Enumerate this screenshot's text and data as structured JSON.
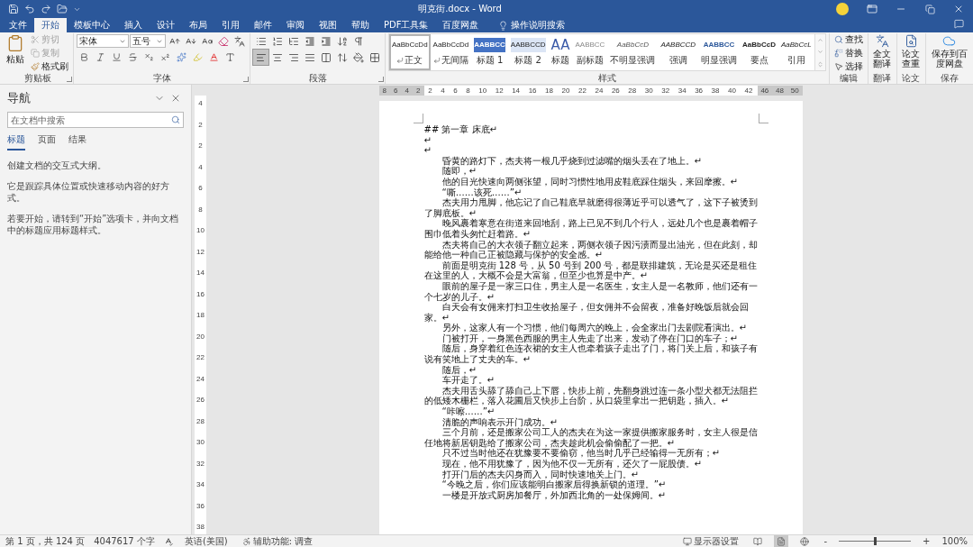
{
  "title_bar": {
    "title": "明克街.docx  -  Word"
  },
  "tabs": [
    {
      "label": "文件",
      "selected": false
    },
    {
      "label": "开始",
      "selected": true
    },
    {
      "label": "模板中心",
      "selected": false
    },
    {
      "label": "插入",
      "selected": false
    },
    {
      "label": "设计",
      "selected": false
    },
    {
      "label": "布局",
      "selected": false
    },
    {
      "label": "引用",
      "selected": false
    },
    {
      "label": "邮件",
      "selected": false
    },
    {
      "label": "审阅",
      "selected": false
    },
    {
      "label": "视图",
      "selected": false
    },
    {
      "label": "帮助",
      "selected": false
    },
    {
      "label": "PDF工具集",
      "selected": false
    },
    {
      "label": "百度网盘",
      "selected": false
    }
  ],
  "tell_me": "操作说明搜索",
  "clipboard": {
    "label": "剪贴板",
    "paste": "粘贴",
    "cut": {
      "label": "剪切",
      "disabled": true
    },
    "copy": {
      "label": "复制",
      "disabled": true
    },
    "format_painter": "格式刷"
  },
  "font": {
    "label": "字体",
    "name": "宋体",
    "size": "五号"
  },
  "paragraph": {
    "label": "段落",
    "alignments": [
      {
        "kind": "left",
        "selected": true
      },
      {
        "kind": "center",
        "selected": false
      },
      {
        "kind": "right",
        "selected": false
      },
      {
        "kind": "justify",
        "selected": false
      },
      {
        "kind": "distributed",
        "selected": false
      }
    ]
  },
  "styles": {
    "label": "样式",
    "items": [
      {
        "kind": "normal",
        "preview": "AaBbCcDd",
        "name": "正文",
        "selected": true
      },
      {
        "kind": "nospace",
        "preview": "AaBbCcDd",
        "name": "无间隔",
        "selected": false
      },
      {
        "kind": "h1",
        "preview": "AABBCC",
        "name": "标题 1",
        "selected": false
      },
      {
        "kind": "h2",
        "preview": "AABBCCD",
        "name": "标题 2",
        "selected": false
      },
      {
        "kind": "title",
        "preview": "AA",
        "name": "标题",
        "selected": false
      },
      {
        "kind": "subtitle",
        "preview": "AABBCC",
        "name": "副标题",
        "selected": false
      },
      {
        "kind": "subtle",
        "preview": "AaBbCcD",
        "name": "不明显强调",
        "selected": false
      },
      {
        "kind": "emphasis",
        "preview": "AABBCCD",
        "name": "强调",
        "selected": false
      },
      {
        "kind": "intense",
        "preview": "AABBCC",
        "name": "明显强调",
        "selected": false
      },
      {
        "kind": "strong",
        "preview": "AaBbCcD",
        "name": "要点",
        "selected": false
      },
      {
        "kind": "quote",
        "preview": "AaBbCcL",
        "name": "引用",
        "selected": false
      }
    ]
  },
  "editing": {
    "label": "编辑",
    "find": "查找",
    "replace": "替换",
    "select": "选择"
  },
  "translate": {
    "label": "翻译",
    "button": "全文翻译"
  },
  "thesis": {
    "label": "论文",
    "button": "论文查重"
  },
  "save": {
    "label": "保存",
    "button": "保存到百度网盘"
  },
  "nav": {
    "title": "导航",
    "search_placeholder": "在文档中搜索",
    "tabs": [
      {
        "label": "标题",
        "selected": true
      },
      {
        "label": "页面",
        "selected": false
      },
      {
        "label": "结果",
        "selected": false
      }
    ],
    "help": [
      "创建文档的交互式大纲。",
      "它是跟踪具体位置或快速移动内容的好方式。",
      "若要开始，请转到“开始”选项卡，并向文档中的标题应用标题样式。"
    ]
  },
  "ruler": {
    "left_ticks": [
      "8",
      "6",
      "4",
      "2"
    ],
    "ticks": [
      "2",
      "4",
      "6",
      "8",
      "10",
      "12",
      "14",
      "16",
      "18",
      "20",
      "22",
      "24",
      "26",
      "28",
      "30",
      "32",
      "34",
      "36",
      "38",
      "40",
      "42"
    ],
    "right_ticks": [
      "46",
      "48",
      "50"
    ],
    "vertical_ticks": [
      "4",
      "2",
      "2",
      "4",
      "6",
      "8",
      "10",
      "12",
      "14",
      "16",
      "18",
      "20",
      "22",
      "24",
      "26",
      "28",
      "30",
      "32",
      "34",
      "36",
      "38"
    ]
  },
  "document": {
    "paragraphs": [
      {
        "kind": "heading",
        "text": "## 第一章 床底↵"
      },
      {
        "kind": "empty",
        "text": "↵"
      },
      {
        "kind": "empty",
        "text": "↵"
      },
      {
        "kind": "body",
        "text": "昏黄的路灯下，杰夫将一根几乎烧到过滤嘴的烟头丢在了地上。↵"
      },
      {
        "kind": "body",
        "text": "随即，↵"
      },
      {
        "kind": "body",
        "text": "他的目光快速向两侧张望，同时习惯性地用皮鞋底踩住烟头，来回摩擦。↵"
      },
      {
        "kind": "body",
        "text": "“嘶……该死……”↵"
      },
      {
        "kind": "body",
        "text": "杰夫用力甩脚，他忘记了自己鞋底早就磨得很薄近乎可以透气了，这下子被烫到了脚底板。↵"
      },
      {
        "kind": "body",
        "text": "晚风裹着寒意在街道来回地刮，路上已见不到几个行人，远处几个也是裹着帽子围巾低着头匆忙赶着路。↵"
      },
      {
        "kind": "body",
        "text": "杰夫将自己的大衣领子翻立起来，两侧衣领子因污渍而显出油光，但在此刻，却能给他一种自己正被隐藏与保护的安全感。↵"
      },
      {
        "kind": "body",
        "text": "前面是明克街 128 号，从 50 号到 200 号，都是联排建筑，无论是买还是租住在这里的人，大概不会是大富翁，但至少也算是中产。↵"
      },
      {
        "kind": "body",
        "text": "眼前的屋子是一家三口住，男主人是一名医生，女主人是一名教师，他们还有一个七岁的儿子。↵"
      },
      {
        "kind": "body",
        "text": "白天会有女佣来打扫卫生收拾屋子，但女佣并不会留夜，准备好晚饭后就会回家。↵"
      },
      {
        "kind": "body",
        "text": "另外，这家人有一个习惯，他们每周六的晚上，会全家出门去剧院看演出。↵"
      },
      {
        "kind": "body",
        "text": "门被打开，一身黑色西服的男主人先走了出来，发动了停在门口的车子；↵"
      },
      {
        "kind": "body",
        "text": "随后，身穿着红色连衣裙的女主人也牵着孩子走出了门，将门关上后，和孩子有说有笑地上了丈夫的车。↵"
      },
      {
        "kind": "body",
        "text": "随后，↵"
      },
      {
        "kind": "body",
        "text": "车开走了。↵"
      },
      {
        "kind": "body",
        "text": "杰夫用舌头舔了舔自己上下唇，快步上前，先翻身跳过连一条小型犬都无法阻拦的低矮木栅栏，落入花圃后又快步上台阶，从口袋里拿出一把钥匙，插入。↵"
      },
      {
        "kind": "body",
        "text": "“咔嚓……”↵"
      },
      {
        "kind": "body",
        "text": "清脆的声响表示开门成功。↵"
      },
      {
        "kind": "body",
        "text": "三个月前，还是搬家公司工人的杰夫在为这一家提供搬家服务时，女主人很是信任地将新居钥匙给了搬家公司，杰夫趁此机会偷偷配了一把。↵"
      },
      {
        "kind": "body",
        "text": "只不过当时他还在犹豫要不要偷窃，他当时几乎已经输得一无所有；↵"
      },
      {
        "kind": "body",
        "text": "现在，他不用犹豫了，因为他不仅一无所有，还欠了一屁股债。↵"
      },
      {
        "kind": "body",
        "text": "打开门后的杰夫闪身而入，同时快速地关上门。↵"
      },
      {
        "kind": "body",
        "text": "“今晚之后，你们应该能明白搬家后得换新锁的道理。”↵"
      },
      {
        "kind": "body",
        "text": "一楼是开放式厨房加餐厅，外加西北角的一处保姆间。↵"
      }
    ]
  },
  "status_bar": {
    "page": "第 1 页，共 124 页",
    "words": "4047617 个字",
    "language": "英语(美国)",
    "accessibility": "辅助功能: 调查",
    "display": "显示器设置",
    "views": [
      {
        "kind": "read",
        "selected": false
      },
      {
        "kind": "print",
        "selected": true
      },
      {
        "kind": "web",
        "selected": false
      }
    ],
    "zoom_out": "-",
    "zoom_in": "+",
    "zoom": {
      "level": 0.5
    },
    "zoom_text": "100%"
  }
}
